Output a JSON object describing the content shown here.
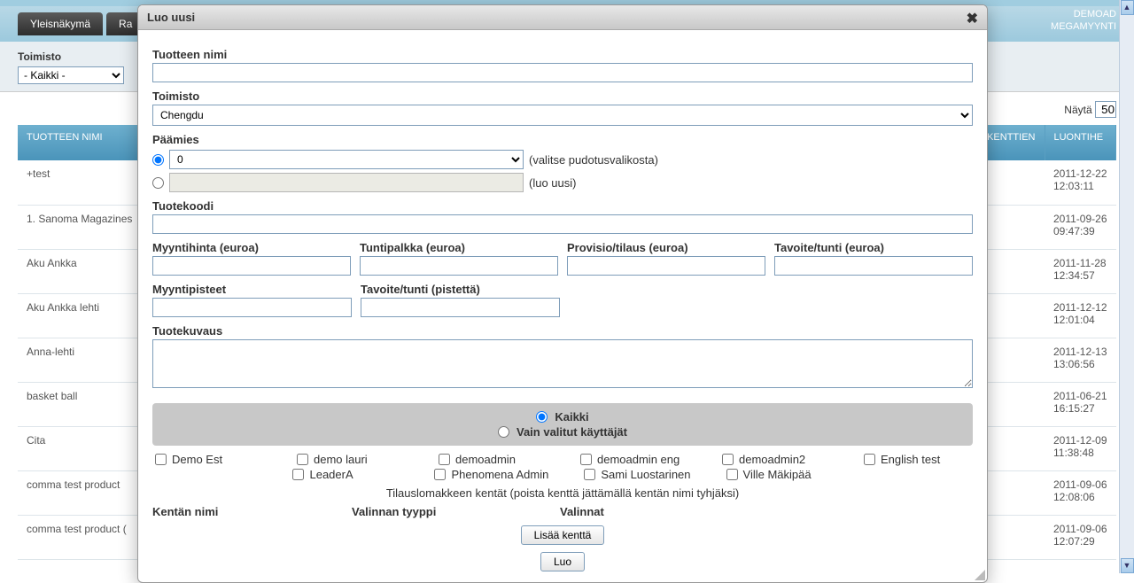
{
  "header": {
    "tabs": [
      "Yleisnäkymä",
      "Ra"
    ],
    "top_right_line1": "DEMOAD",
    "top_right_line2": "MEGAMYYNTI "
  },
  "filter": {
    "label": "Toimisto",
    "value": "- Kaikki -"
  },
  "list": {
    "show_label": "Näytä",
    "show_value": "50",
    "columns": {
      "name": "TUOTTEEN NIMI",
      "fields": "KEKENTTIEN \nÄ",
      "created": "LUONTIHE"
    },
    "rows": [
      {
        "name": "+test",
        "date": "2011-12-22",
        "time": "12:03:11"
      },
      {
        "name": "1. Sanoma Magazines",
        "date": "2011-09-26",
        "time": "09:47:39"
      },
      {
        "name": "Aku Ankka",
        "date": "2011-11-28",
        "time": "12:34:57"
      },
      {
        "name": "Aku Ankka lehti",
        "date": "2011-12-12",
        "time": "12:01:04"
      },
      {
        "name": "Anna-lehti",
        "date": "2011-12-13",
        "time": "13:06:56"
      },
      {
        "name": "basket ball",
        "date": "2011-06-21",
        "time": "16:15:27"
      },
      {
        "name": "Cita",
        "date": "2011-12-09",
        "time": "11:38:48"
      },
      {
        "name": "comma test product",
        "date": "2011-09-06",
        "time": "12:08:06"
      },
      {
        "name": "comma test product (",
        "date": "2011-09-06",
        "time": "12:07:29"
      }
    ]
  },
  "modal": {
    "title": "Luo uusi",
    "labels": {
      "product_name": "Tuotteen nimi",
      "office": "Toimisto",
      "principal": "Päämies",
      "dropdown_hint": "(valitse pudotusvalikosta)",
      "create_hint": "(luo uusi)",
      "product_code": "Tuotekoodi",
      "sale_price": "Myyntihinta (euroa)",
      "hourly": "Tuntipalkka (euroa)",
      "commission": "Provisio/tilaus (euroa)",
      "target_eur": "Tavoite/tunti (euroa)",
      "points": "Myyntipisteet",
      "target_pts": "Tavoite/tunti (pistettä)",
      "description": "Tuotekuvaus",
      "all": "Kaikki",
      "only_selected": "Vain valitut käyttäjät",
      "form_note": "Tilauslomakkeen kentät (poista kenttä jättämällä kentän nimi tyhjäksi)",
      "field_name": "Kentän nimi",
      "selection_type": "Valinnan tyyppi",
      "selections": "Valinnat",
      "add_field": "Lisää kenttä",
      "create": "Luo"
    },
    "office_value": "Chengdu",
    "principal_dropdown_value": "0",
    "users": [
      "Demo Est",
      "demo lauri",
      "demoadmin",
      "demoadmin eng",
      "demoadmin2",
      "English test",
      "LeaderA",
      "Phenomena Admin",
      "Sami Luostarinen",
      "Ville Mäkipää"
    ]
  }
}
